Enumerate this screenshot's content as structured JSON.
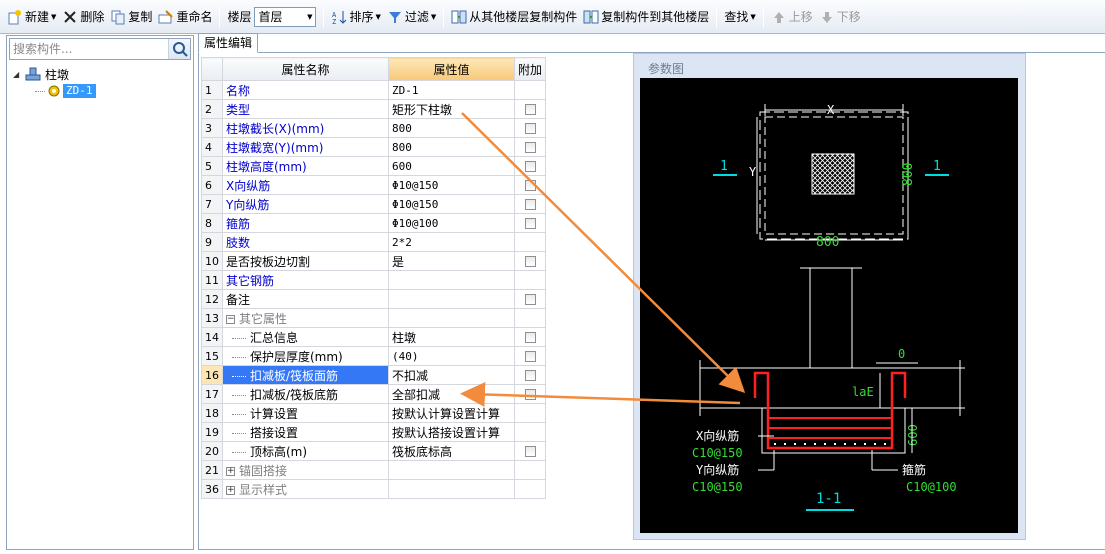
{
  "toolbar": {
    "new_label": "新建",
    "delete_label": "删除",
    "copy_label": "复制",
    "rename_label": "重命名",
    "floor_label": "楼层",
    "floor_value": "首层",
    "sort_label": "排序",
    "filter_label": "过滤",
    "copy_from_other_floor_label": "从其他楼层复制构件",
    "copy_to_other_floor_label": "复制构件到其他楼层",
    "find_label": "查找",
    "move_up_label": "上移",
    "move_down_label": "下移"
  },
  "left_panel": {
    "search_placeholder": "搜索构件...",
    "tree_root_label": "柱墩",
    "tree_child_label": "ZD-1"
  },
  "tabs": {
    "active_label": "属性编辑"
  },
  "property_grid": {
    "headers": {
      "name": "属性名称",
      "value": "属性值",
      "extra": "附加"
    },
    "rows": [
      {
        "num": "1",
        "name": "名称",
        "value": "ZD-1",
        "checkbox": false,
        "style": "blue"
      },
      {
        "num": "2",
        "name": "类型",
        "value": "矩形下柱墩",
        "checkbox": true,
        "style": "blue"
      },
      {
        "num": "3",
        "name": "柱墩截长(X)(mm)",
        "value": "800",
        "checkbox": true,
        "style": "blue"
      },
      {
        "num": "4",
        "name": "柱墩截宽(Y)(mm)",
        "value": "800",
        "checkbox": true,
        "style": "blue"
      },
      {
        "num": "5",
        "name": "柱墩高度(mm)",
        "value": "600",
        "checkbox": true,
        "style": "blue"
      },
      {
        "num": "6",
        "name": "X向纵筋",
        "value": "Φ10@150",
        "checkbox": true,
        "style": "blue"
      },
      {
        "num": "7",
        "name": "Y向纵筋",
        "value": "Φ10@150",
        "checkbox": true,
        "style": "blue"
      },
      {
        "num": "8",
        "name": "箍筋",
        "value": "Φ10@100",
        "checkbox": true,
        "style": "blue"
      },
      {
        "num": "9",
        "name": "肢数",
        "value": "2*2",
        "checkbox": false,
        "style": "blue"
      },
      {
        "num": "10",
        "name": "是否按板边切割",
        "value": "是",
        "checkbox": true,
        "style": "black"
      },
      {
        "num": "11",
        "name": "其它钢筋",
        "value": "",
        "checkbox": false,
        "style": "blue"
      },
      {
        "num": "12",
        "name": "备注",
        "value": "",
        "checkbox": true,
        "style": "black"
      },
      {
        "num": "13",
        "name": "其它属性",
        "value": "",
        "checkbox": false,
        "style": "group-open"
      },
      {
        "num": "14",
        "name": "汇总信息",
        "value": "柱墩",
        "checkbox": true,
        "style": "sub"
      },
      {
        "num": "15",
        "name": "保护层厚度(mm)",
        "value": "(40)",
        "checkbox": true,
        "style": "sub"
      },
      {
        "num": "16",
        "name": "扣减板/筏板面筋",
        "value": "不扣减",
        "checkbox": true,
        "style": "sub-selected"
      },
      {
        "num": "17",
        "name": "扣减板/筏板底筋",
        "value": "全部扣减",
        "checkbox": true,
        "style": "sub"
      },
      {
        "num": "18",
        "name": "计算设置",
        "value": "按默认计算设置计算",
        "checkbox": false,
        "style": "sub"
      },
      {
        "num": "19",
        "name": "搭接设置",
        "value": "按默认搭接设置计算",
        "checkbox": false,
        "style": "sub"
      },
      {
        "num": "20",
        "name": "顶标高(m)",
        "value": "筏板底标高",
        "checkbox": true,
        "style": "sub"
      },
      {
        "num": "21",
        "name": "锚固搭接",
        "value": "",
        "checkbox": false,
        "style": "group-closed"
      },
      {
        "num": "36",
        "name": "显示样式",
        "value": "",
        "checkbox": false,
        "style": "group-closed"
      }
    ]
  },
  "param_diagram": {
    "title": "参数图",
    "plan_x_label": "X",
    "plan_y_label": "Y",
    "plan_dim_x": "800",
    "plan_dim_y": "800",
    "section_mark": "1",
    "dim_zero": "0",
    "lae_label": "laE",
    "dim_height": "600",
    "x_rebar_label": "X向纵筋",
    "x_rebar_value": "C10@150",
    "y_rebar_label": "Y向纵筋",
    "y_rebar_value": "C10@150",
    "stirrup_label": "箍筋",
    "stirrup_value": "C10@100",
    "section_title": "1-1"
  },
  "colors": {
    "accent_orange": "#f28b3c",
    "rebar_red": "#ff2020",
    "dim_green": "#33dd33",
    "cad_cyan": "#00dddd"
  }
}
